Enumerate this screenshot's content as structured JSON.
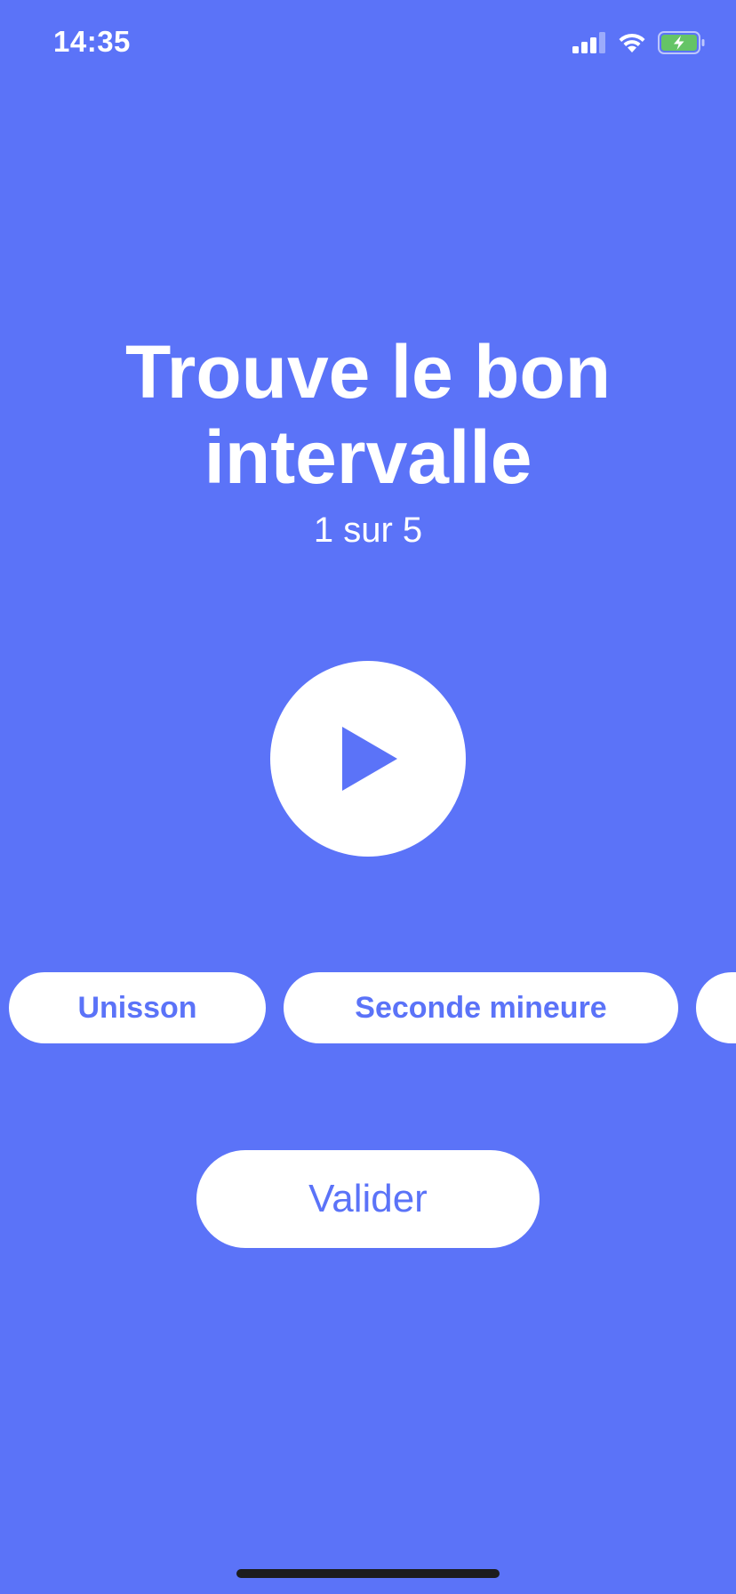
{
  "status_bar": {
    "time": "14:35",
    "icons": [
      "cellular-signal-icon",
      "wifi-icon",
      "battery-charging-icon"
    ]
  },
  "quiz": {
    "title_line1": "Trouve le bon",
    "title_line2": "intervalle",
    "progress": "1 sur 5"
  },
  "play_button": {
    "icon": "play-icon"
  },
  "options": [
    {
      "label": "Unisson"
    },
    {
      "label": "Seconde mineure"
    },
    {
      "label": ""
    }
  ],
  "validate_label": "Valider",
  "colors": {
    "background": "#5b73f8",
    "accent": "#5b73f8",
    "surface": "#ffffff",
    "battery_fill": "#65c466"
  }
}
